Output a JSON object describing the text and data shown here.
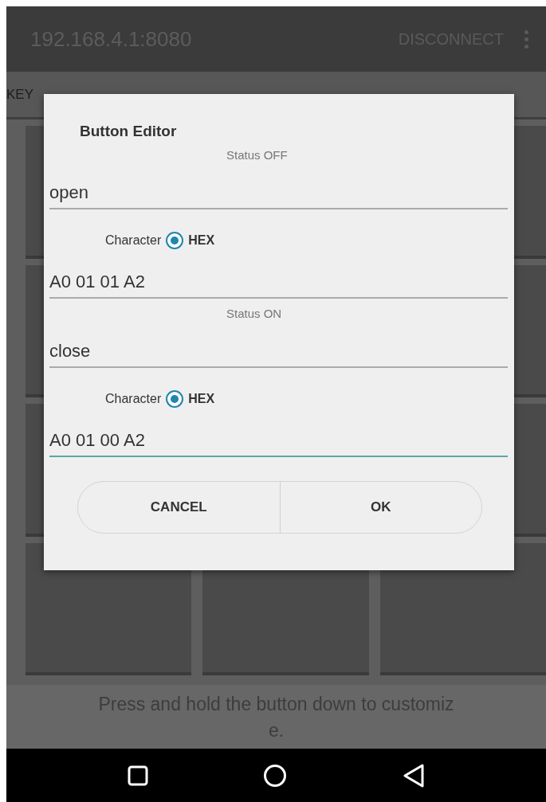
{
  "app_bar": {
    "title": "192.168.4.1:8080",
    "action": "DISCONNECT"
  },
  "tabs": [
    {
      "label": "KEY"
    }
  ],
  "dialog": {
    "title": "Button Editor",
    "sections": [
      {
        "heading": "Status OFF",
        "name_field": {
          "value": "open",
          "focused": false
        },
        "radios": [
          {
            "label": "Character",
            "selected": false
          },
          {
            "label": "HEX",
            "selected": true
          }
        ],
        "code_field": {
          "value": "A0 01 01 A2",
          "focused": false
        }
      },
      {
        "heading": "Status ON",
        "name_field": {
          "value": "close",
          "focused": false
        },
        "radios": [
          {
            "label": "Character",
            "selected": false
          },
          {
            "label": "HEX",
            "selected": true
          }
        ],
        "code_field": {
          "value": "A0 01 00 A2",
          "focused": true
        }
      }
    ],
    "buttons": [
      "CANCEL",
      "OK"
    ]
  },
  "hint": "Press and hold the button down to customiz\ne."
}
